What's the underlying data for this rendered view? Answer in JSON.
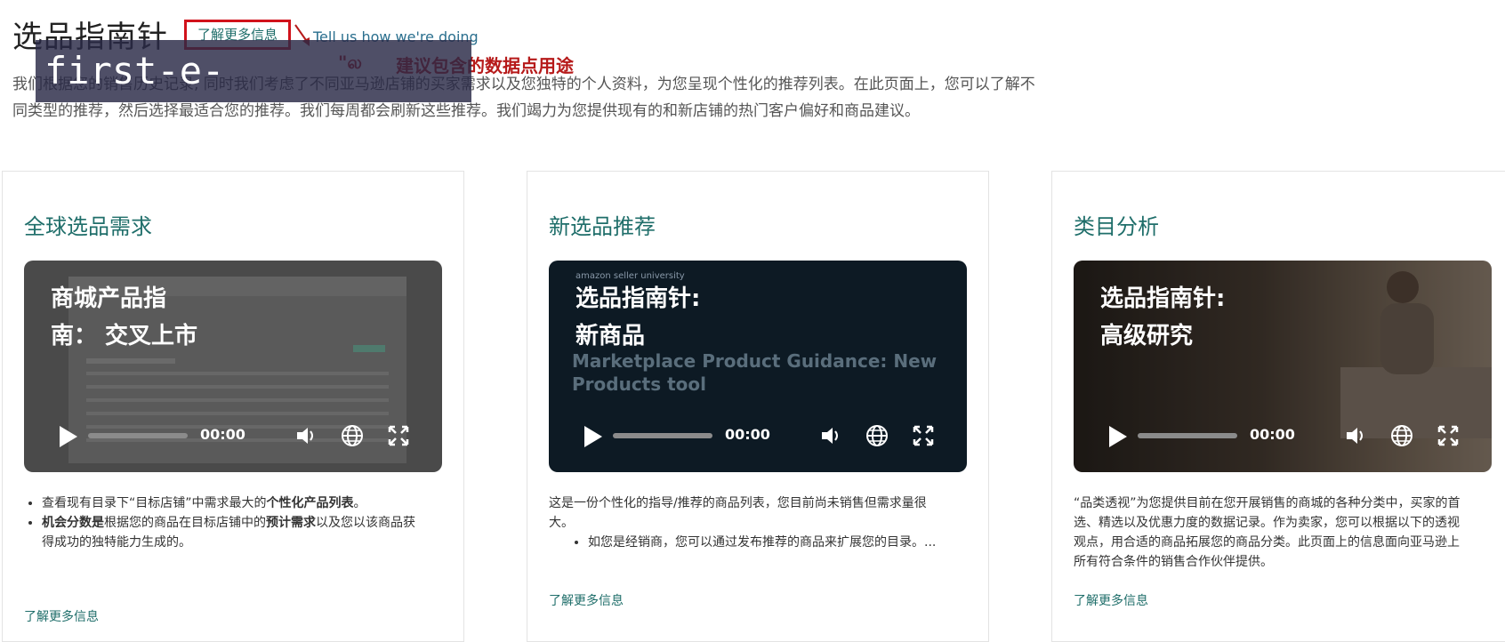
{
  "page": {
    "title": "选品指南针",
    "learn_more_label": "了解更多信息",
    "tell_us": "Tell us how we're doing",
    "annotation_prefix": "\"ல",
    "annotation": "建议包含的数据点用途",
    "intro": "我们根据您的销售历史记录, 同时我们考虑了不同亚马逊店铺的买家需求以及您独特的个人资料，为您呈现个性化的推荐列表。在此页面上，您可以了解不同类型的推荐，然后选择最适合您的推荐。我们每周都会刷新这些推荐。我们竭力为您提供现有的和新店铺的热门客户偏好和商品建议。",
    "watermark": "first-e-kaiyun.com.cn"
  },
  "cards": [
    {
      "title": "全球选品需求",
      "video": {
        "caption_line1": "商城产品指",
        "caption_line2": "南： 交叉上市",
        "subtitle_line1": "",
        "subtitle_line2": "",
        "brand": "",
        "time": "00:00"
      },
      "bullets": [
        {
          "pre": "查看现有目录下“目标店铺”中需求最大的",
          "bold": "个性化产品列表",
          "post": "。"
        },
        {
          "pre": "",
          "bold": "机会分数是",
          "post": "根据您的商品在目标店铺中的",
          "bold2": "预计需求",
          "post2": "以及您以该商品获得成功的独特能力生成的。"
        }
      ],
      "link": "了解更多信息"
    },
    {
      "title": "新选品推荐",
      "video": {
        "caption_line1": "选品指南针:",
        "caption_line2": "新商品",
        "subtitle_line1": "Marketplace Product Guidance: New",
        "subtitle_line2": "Products tool",
        "brand": "amazon seller university",
        "time": "00:00"
      },
      "paragraph": "这是一份个性化的指导/推荐的商品列表，您目前尚未销售但需求量很大。",
      "sub_bullet": "如您是经销商，您可以通过发布推荐的商品来扩展您的目录。...",
      "link": "了解更多信息"
    },
    {
      "title": "类目分析",
      "video": {
        "caption_line1": "选品指南针:",
        "caption_line2": "高级研究",
        "subtitle_line1": "",
        "subtitle_line2": "",
        "brand": "",
        "time": "00:00"
      },
      "paragraph": "“品类透视”为您提供目前在您开展销售的商城的各种分类中，买家的首选、精选以及优惠力度的数据记录。作为卖家，您可以根据以下的透视观点，用合适的商品拓展您的商品分类。此页面上的信息面向亚马逊上所有符合条件的销售合作伙伴提供。",
      "link": "了解更多信息"
    }
  ]
}
